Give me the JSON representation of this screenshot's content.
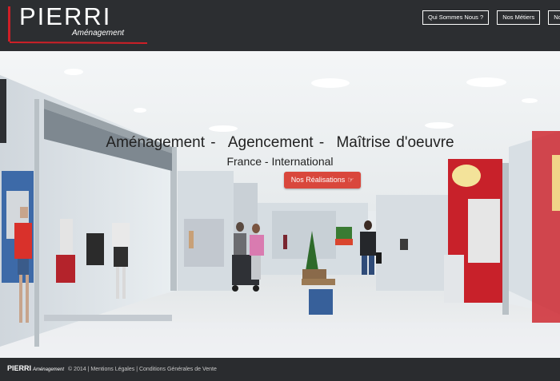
{
  "brand": {
    "name": "PIERRI",
    "tagline": "Aménagement",
    "accent_color": "#cf1f27"
  },
  "nav": {
    "items": [
      "Qui Sommes Nous ?",
      "Nos Métiers",
      "Nos Référ"
    ]
  },
  "hero": {
    "title_parts": [
      "Aménagement -",
      "Agencement -",
      "Maîtrise d'oeuvre"
    ],
    "subtitle": "France - International",
    "cta_label": "Nos Réalisations",
    "cta_icon": "hand-pointing-right-icon",
    "cta_color": "#d9473c"
  },
  "footer": {
    "brand": "PIERRI",
    "brand_sub": "Aménagement",
    "copyright": "© 2014 |",
    "link_legal": "Mentions Légales",
    "separator": "|",
    "link_cgv": "Conditions Générales de Vente"
  }
}
